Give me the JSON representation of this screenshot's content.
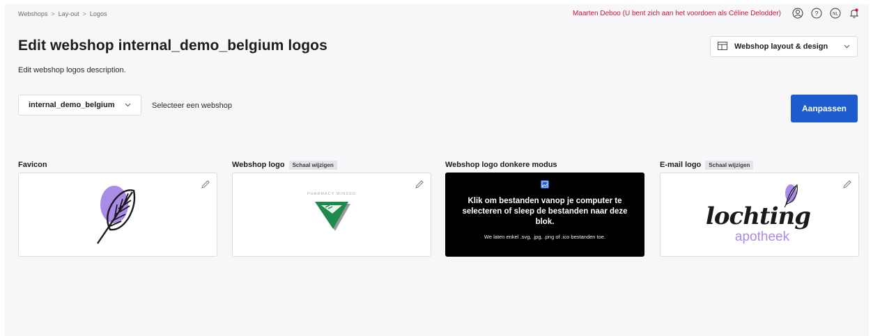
{
  "breadcrumb": [
    "Webshops",
    "Lay-out",
    "Logos"
  ],
  "breadcrumb_sep": ">",
  "user": {
    "impersonation_text": "Maarten Deboo (U bent zich aan het voordoen als Céline Delodder)",
    "language": "NL"
  },
  "header": {
    "title": "Edit webshop internal_demo_belgium logos",
    "subtitle": "Edit webshop logos description."
  },
  "layout_menu": {
    "label": "Webshop layout & design"
  },
  "webshop_select": {
    "value": "internal_demo_belgium",
    "hint": "Selecteer een webshop"
  },
  "actions": {
    "save_label": "Aanpassen"
  },
  "logos": {
    "favicon": {
      "label": "Favicon"
    },
    "webshop": {
      "label": "Webshop logo",
      "badge": "Schaal wijzigen",
      "brand_text": "PHARMACY WINDED"
    },
    "dark": {
      "label": "Webshop logo donkere modus",
      "drop_title": "Klik om bestanden vanop je computer te selecteren of sleep de bestanden naar deze blok.",
      "drop_note": "We laten enkel .svg, .jpg, .png of .ico bestanden toe."
    },
    "email": {
      "label": "E-mail logo",
      "badge": "Schaal wijzigen",
      "brand_name": "lochting",
      "brand_sub": "apotheek"
    }
  },
  "colors": {
    "accent": "#1d5bcf",
    "impersonation": "#d0103a",
    "leaf_purple": "#a98be8",
    "pharmacy_green": "#1e8a4c"
  }
}
